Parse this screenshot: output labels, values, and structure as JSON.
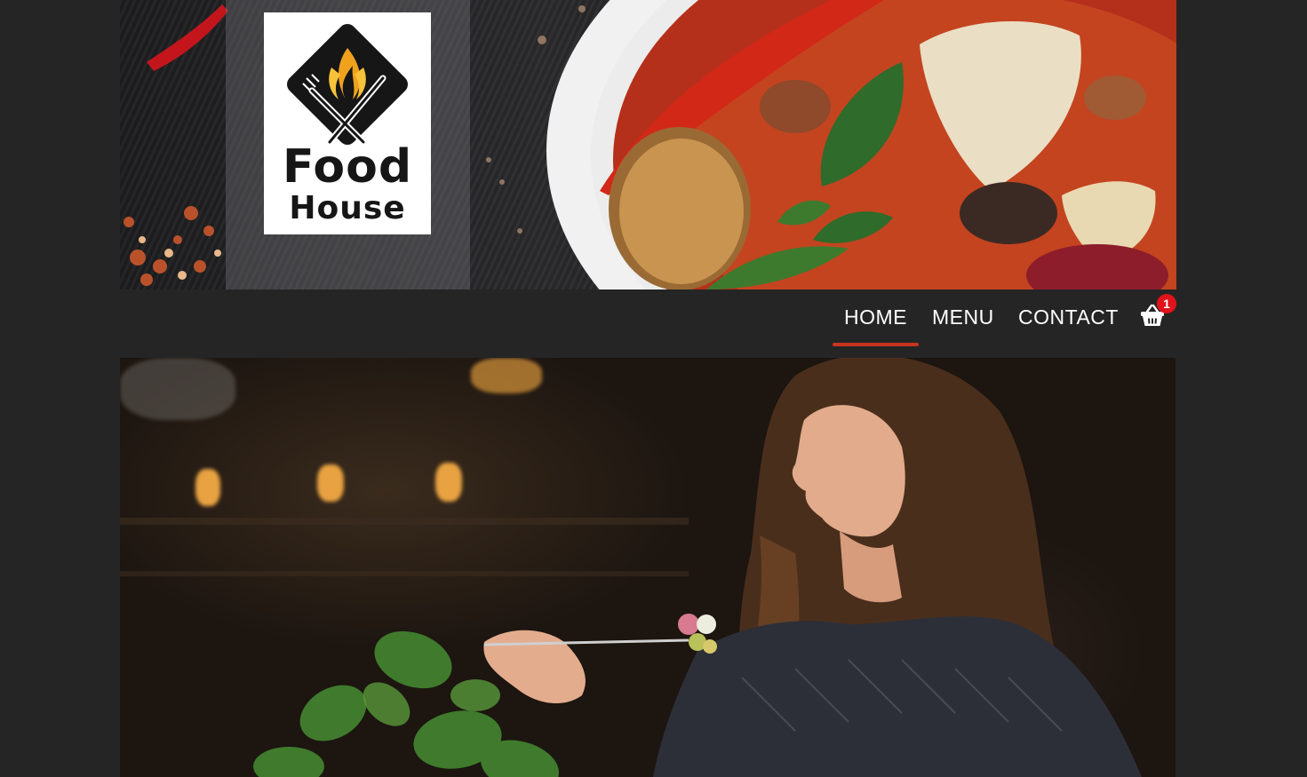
{
  "brand": {
    "logo_line1": "Food",
    "logo_line2": "House"
  },
  "nav": {
    "items": [
      {
        "label": "HOME",
        "active": true
      },
      {
        "label": "MENU",
        "active": false
      },
      {
        "label": "CONTACT",
        "active": false
      }
    ],
    "cart": {
      "icon": "shopping-basket-icon",
      "count": "1"
    }
  },
  "colors": {
    "background": "#252525",
    "active_underline": "#c8331f",
    "badge": "#e0131b",
    "nav_text": "#ffffff"
  }
}
